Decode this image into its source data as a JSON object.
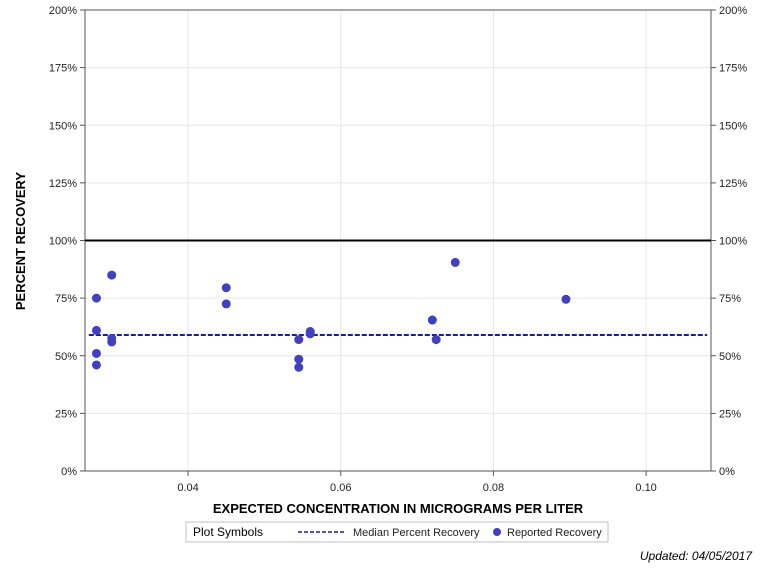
{
  "chart_data": {
    "type": "scatter",
    "xlabel": "EXPECTED CONCENTRATION IN MICROGRAMS PER LITER",
    "ylabel": "PERCENT RECOVERY",
    "xlim": [
      0.0265,
      0.1085
    ],
    "ylim": [
      0,
      200
    ],
    "x_ticks": [
      0.04,
      0.06,
      0.08,
      0.1
    ],
    "x_tick_labels": [
      "0.04",
      "0.06",
      "0.08",
      "0.10"
    ],
    "y_ticks": [
      0,
      25,
      50,
      75,
      100,
      125,
      150,
      175,
      200
    ],
    "y_tick_labels": [
      "0%",
      "25%",
      "50%",
      "75%",
      "100%",
      "125%",
      "150%",
      "175%",
      "200%"
    ],
    "grid": true,
    "reference_line": 100,
    "series": [
      {
        "name": "Reported Recovery",
        "points": [
          {
            "x": 0.028,
            "y": 75
          },
          {
            "x": 0.028,
            "y": 61
          },
          {
            "x": 0.028,
            "y": 51
          },
          {
            "x": 0.028,
            "y": 46
          },
          {
            "x": 0.03,
            "y": 85
          },
          {
            "x": 0.03,
            "y": 57.5
          },
          {
            "x": 0.03,
            "y": 56
          },
          {
            "x": 0.045,
            "y": 79.5
          },
          {
            "x": 0.045,
            "y": 72.5
          },
          {
            "x": 0.0545,
            "y": 57
          },
          {
            "x": 0.0545,
            "y": 48.5
          },
          {
            "x": 0.0545,
            "y": 45
          },
          {
            "x": 0.056,
            "y": 60.5
          },
          {
            "x": 0.056,
            "y": 59.5
          },
          {
            "x": 0.072,
            "y": 65.5
          },
          {
            "x": 0.0725,
            "y": 57
          },
          {
            "x": 0.075,
            "y": 90.5
          },
          {
            "x": 0.0895,
            "y": 74.5
          }
        ]
      },
      {
        "name": "Median Percent Recovery",
        "type": "line",
        "value": 59,
        "x_range": [
          0.027,
          0.108
        ]
      }
    ],
    "legend": {
      "title": "Plot Symbols",
      "position": "bottom",
      "entries": [
        "Median Percent Recovery",
        "Reported Recovery"
      ]
    },
    "colors": {
      "points": "#4040c0",
      "median": "#1a1aa6",
      "reference": "#000000",
      "grid": "#e6e6e6",
      "axis": "#555555"
    }
  },
  "footer": {
    "updated": "Updated: 04/05/2017"
  }
}
